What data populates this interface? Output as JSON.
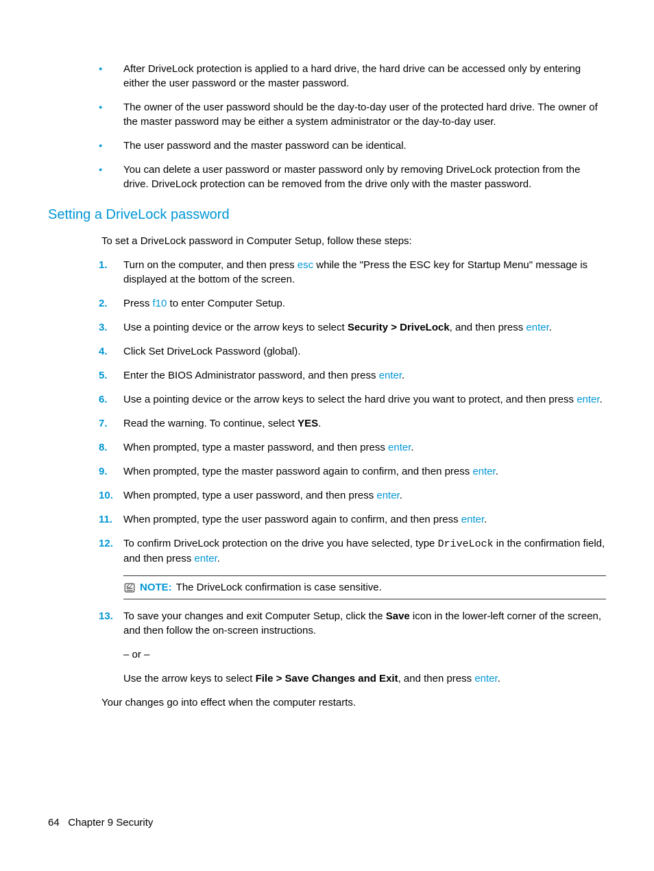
{
  "bullets": [
    "After DriveLock protection is applied to a hard drive, the hard drive can be accessed only by entering either the user password or the master password.",
    "The owner of the user password should be the day-to-day user of the protected hard drive. The owner of the master password may be either a system administrator or the day-to-day user.",
    "The user password and the master password can be identical.",
    "You can delete a user password or master password only by removing DriveLock protection from the drive. DriveLock protection can be removed from the drive only with the master password."
  ],
  "heading": "Setting a DriveLock password",
  "intro": "To set a DriveLock password in Computer Setup, follow these steps:",
  "steps": {
    "s1a": "Turn on the computer, and then press ",
    "s1_key": "esc",
    "s1b": " while the \"Press the ESC key for Startup Menu\" message is displayed at the bottom of the screen.",
    "s2a": "Press ",
    "s2_key": "f10",
    "s2b": " to enter Computer Setup.",
    "s3a": "Use a pointing device or the arrow keys to select ",
    "s3_bold": "Security > DriveLock",
    "s3b": ", and then press ",
    "s3_key": "enter",
    "s3c": ".",
    "s4": "Click Set DriveLock Password (global).",
    "s5a": "Enter the BIOS Administrator password, and then press ",
    "s5_key": "enter",
    "s5b": ".",
    "s6a": "Use a pointing device or the arrow keys to select the hard drive you want to protect, and then press ",
    "s6_key": "enter",
    "s6b": ".",
    "s7a": "Read the warning. To continue, select ",
    "s7_bold": "YES",
    "s7b": ".",
    "s8a": "When prompted, type a master password, and then press ",
    "s8_key": "enter",
    "s8b": ".",
    "s9a": "When prompted, type the master password again to confirm, and then press ",
    "s9_key": "enter",
    "s9b": ".",
    "s10a": "When prompted, type a user password, and then press ",
    "s10_key": "enter",
    "s10b": ".",
    "s11a": "When prompted, type the user password again to confirm, and then press ",
    "s11_key": "enter",
    "s11b": ".",
    "s12a": "To confirm DriveLock protection on the drive you have selected, type ",
    "s12_mono": "DriveLock",
    "s12b": " in the confirmation field, and then press ",
    "s12_key": "enter",
    "s12c": ".",
    "s13a": "To save your changes and exit Computer Setup, click the ",
    "s13_bold": "Save",
    "s13b": " icon in the lower-left corner of the screen, and then follow the on-screen instructions.",
    "s13_or": "– or –",
    "s13c": "Use the arrow keys to select ",
    "s13_bold2": "File > Save Changes and Exit",
    "s13d": ", and then press ",
    "s13_key2": "enter",
    "s13e": "."
  },
  "note": {
    "label": "NOTE:",
    "text": "The DriveLock confirmation is case sensitive."
  },
  "closing": "Your changes go into effect when the computer restarts.",
  "footer": {
    "page": "64",
    "chapter": "Chapter 9   Security"
  }
}
